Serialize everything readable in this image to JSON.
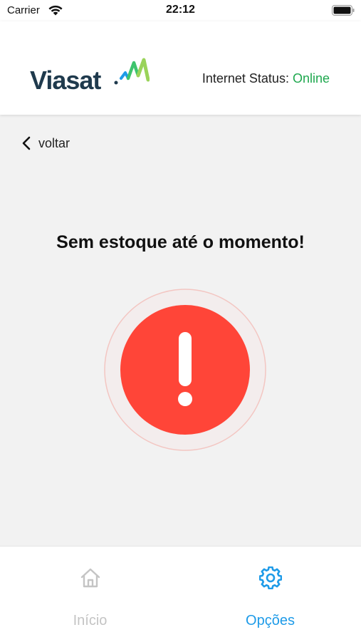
{
  "status_bar": {
    "carrier": "Carrier",
    "time": "22:12",
    "wifi_icon": "wifi-icon",
    "battery_icon": "battery-icon"
  },
  "header": {
    "logo_text": "Viasat",
    "internet_status_label": "Internet Status:",
    "internet_status_value": "Online",
    "status_color": "#1ea84e"
  },
  "back": {
    "label": "voltar",
    "icon": "chevron-left-icon"
  },
  "main": {
    "message": "Sem estoque até o momento!",
    "alert_icon": "exclamation-alert-icon",
    "alert_color": "#ff4538"
  },
  "tabbar": {
    "tabs": [
      {
        "label": "Início",
        "icon": "home-icon",
        "active": false
      },
      {
        "label": "Opções",
        "icon": "gear-icon",
        "active": true
      }
    ],
    "active_color": "#1e9be8",
    "inactive_color": "#c4c4c4"
  }
}
